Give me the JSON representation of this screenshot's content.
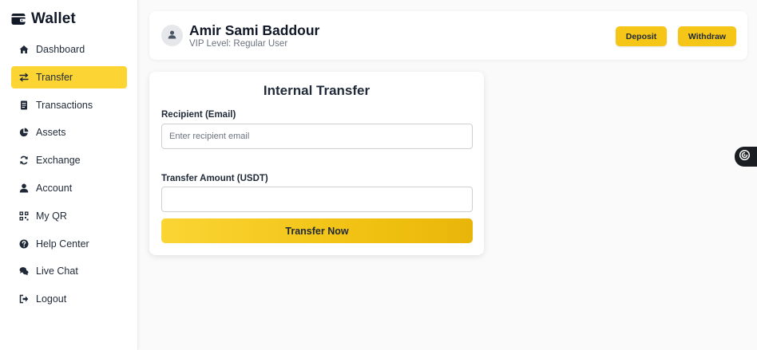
{
  "sidebar": {
    "brand": {
      "title": "Wallet",
      "icon": "wallet-icon"
    },
    "items": [
      {
        "label": "Dashboard",
        "icon": "home-icon",
        "active": false
      },
      {
        "label": "Transfer",
        "icon": "transfer-arrows-icon",
        "active": true
      },
      {
        "label": "Transactions",
        "icon": "receipt-icon",
        "active": false
      },
      {
        "label": "Assets",
        "icon": "pie-chart-icon",
        "active": false
      },
      {
        "label": "Exchange",
        "icon": "sync-icon",
        "active": false
      },
      {
        "label": "Account",
        "icon": "user-icon",
        "active": false
      },
      {
        "label": "My QR",
        "icon": "qr-code-icon",
        "active": false
      },
      {
        "label": "Help Center",
        "icon": "question-circle-icon",
        "active": false
      },
      {
        "label": "Live Chat",
        "icon": "chat-bubbles-icon",
        "active": false
      },
      {
        "label": "Logout",
        "icon": "logout-icon",
        "active": false
      }
    ]
  },
  "header": {
    "user_name": "Amir Sami Baddour",
    "vip_level": "VIP Level: Regular User",
    "deposit_label": "Deposit",
    "withdraw_label": "Withdraw"
  },
  "transfer_form": {
    "title": "Internal Transfer",
    "recipient_label": "Recipient (Email)",
    "recipient_placeholder": "Enter recipient email",
    "recipient_value": "",
    "amount_label": "Transfer Amount (USDT)",
    "amount_value": "",
    "submit_label": "Transfer Now"
  },
  "colors": {
    "accent": "#fcd535",
    "button": "#f5c518",
    "text": "#1f2937",
    "muted": "#6b7280",
    "widget": "#1a1d21"
  },
  "float_widget": {
    "icon": "support-widget-icon"
  }
}
